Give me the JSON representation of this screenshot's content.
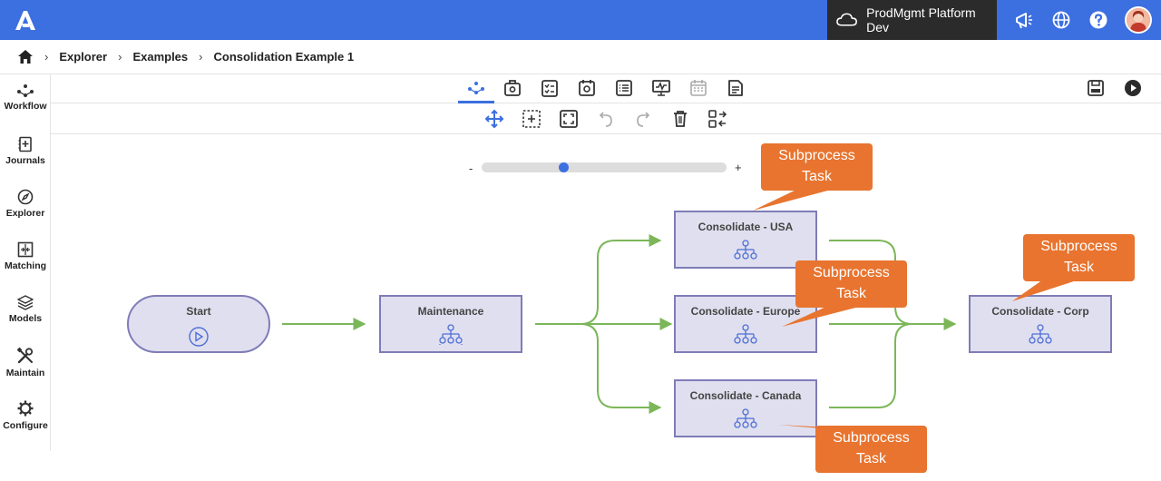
{
  "header": {
    "environment": "ProdMgmt Platform Dev",
    "icons": [
      "app-logo-icon",
      "cloud-icon",
      "megaphone-icon",
      "globe-icon",
      "help-icon",
      "avatar"
    ]
  },
  "breadcrumb": {
    "items": [
      "Explorer",
      "Examples",
      "Consolidation Example 1"
    ]
  },
  "sidebar": {
    "items": [
      {
        "label": "Workflow",
        "icon": "workflow-icon"
      },
      {
        "label": "Journals",
        "icon": "journals-icon"
      },
      {
        "label": "Explorer",
        "icon": "compass-icon"
      },
      {
        "label": "Matching",
        "icon": "matching-icon"
      },
      {
        "label": "Models",
        "icon": "layers-icon"
      },
      {
        "label": "Maintain",
        "icon": "tools-icon"
      },
      {
        "label": "Configure",
        "icon": "gear-icon"
      }
    ]
  },
  "zoom": {
    "minus": "-",
    "plus": "+",
    "level": 0.33
  },
  "workflow": {
    "nodes": {
      "start": "Start",
      "maintenance": "Maintenance",
      "usa": "Consolidate - USA",
      "europe": "Consolidate - Europe",
      "canada": "Consolidate - Canada",
      "corp": "Consolidate - Corp"
    },
    "callouts": {
      "usa": {
        "line1": "Subprocess",
        "line2": "Task"
      },
      "europe": {
        "line1": "Subprocess",
        "line2": "Task"
      },
      "canada": {
        "line1": "Subprocess",
        "line2": "Task"
      },
      "corp": {
        "line1": "Subprocess",
        "line2": "Task"
      }
    }
  },
  "colors": {
    "accent": "#3c6fe0",
    "node_fill": "#e0dfef",
    "node_border": "#7f7cb8",
    "connector": "#7cb65a",
    "callout": "#e8742f"
  }
}
